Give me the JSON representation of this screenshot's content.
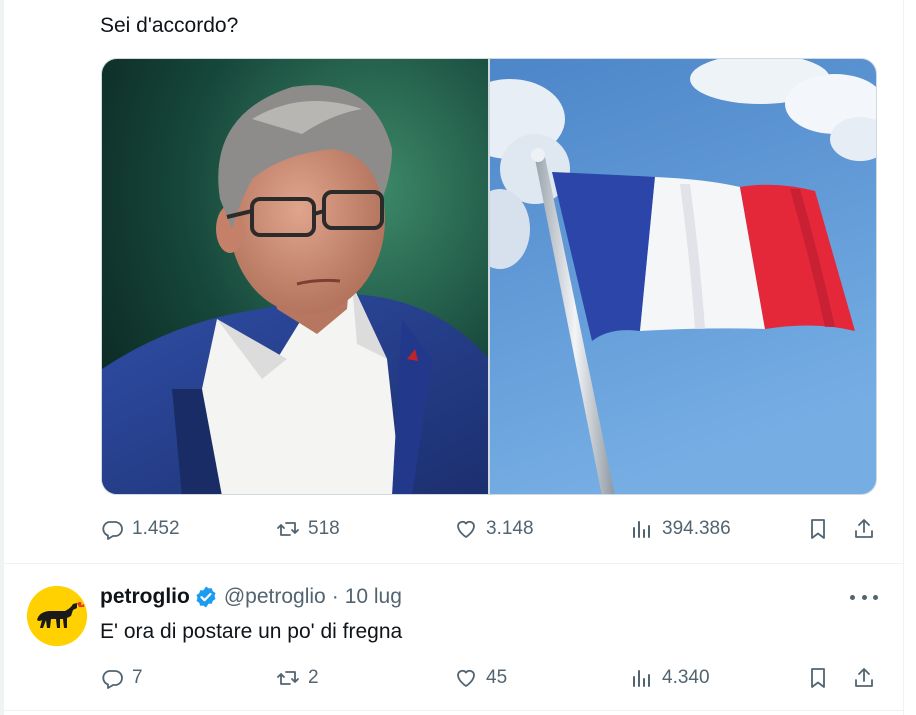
{
  "colors": {
    "text_primary": "#0f1419",
    "text_secondary": "#536471",
    "verified": "#1d9bf0",
    "avatar_bg": "#ffd100"
  },
  "tweet": {
    "text": "Sei d'accordo?",
    "media": [
      {
        "label": "photo-portrait-man-glasses"
      },
      {
        "label": "photo-french-flag"
      }
    ],
    "actions": {
      "replies": "1.452",
      "reposts": "518",
      "likes": "3.148",
      "views": "394.386"
    }
  },
  "reply": {
    "display_name": "petroglio",
    "handle": "@petroglio",
    "separator": "·",
    "time": "10 lug",
    "text": "E' ora di postare un po' di fregna",
    "actions": {
      "replies": "7",
      "reposts": "2",
      "likes": "45",
      "views": "4.340"
    }
  }
}
